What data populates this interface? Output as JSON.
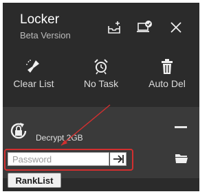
{
  "header": {
    "title": "Locker",
    "subtitle": "Beta Version",
    "buttons": [
      {
        "name": "add-file",
        "icon": "tray-plus-icon"
      },
      {
        "name": "device-check",
        "icon": "laptop-check-icon"
      },
      {
        "name": "close",
        "icon": "close-icon"
      }
    ]
  },
  "toolbar": {
    "clear_list": "Clear List",
    "no_task": "No Task",
    "auto_del": "Auto Del"
  },
  "item": {
    "name": "",
    "description": "Decrypt 2GB",
    "password_placeholder": "Password"
  },
  "tooltip": {
    "label": "RankList"
  },
  "colors": {
    "background": "#2b2b2b",
    "item_background": "#3a3a3a",
    "highlight": "#d32f2f"
  }
}
